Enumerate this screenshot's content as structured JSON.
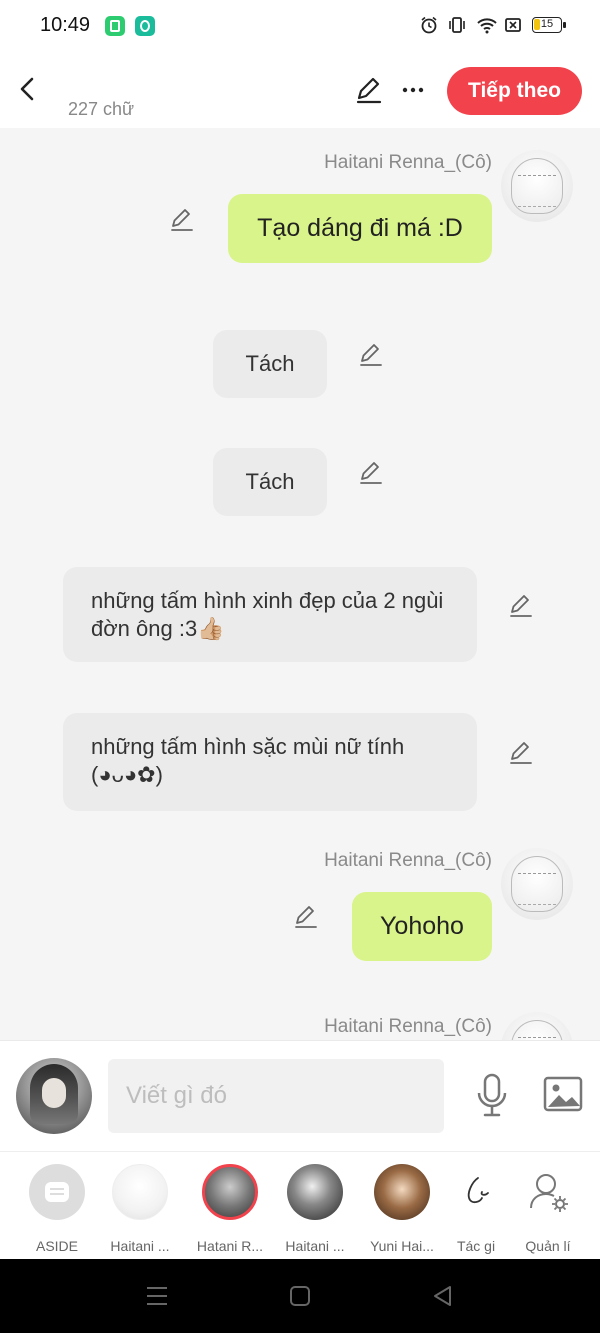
{
  "status_bar": {
    "time": "10:49",
    "battery": "15",
    "icons": [
      "app-battery-icon",
      "app-gear-icon",
      "alarm-icon",
      "vibrate-icon",
      "wifi-icon",
      "sim-off-icon",
      "battery-icon"
    ]
  },
  "top_bar": {
    "word_count": "227 chữ",
    "next_label": "Tiếp theo",
    "next_color": "#f2434d"
  },
  "messages": [
    {
      "type": "character",
      "sender": "Haitani Renna_(Cô)",
      "text": "Tạo dáng đi má :D"
    },
    {
      "type": "narration",
      "text": "Tách"
    },
    {
      "type": "narration",
      "text": "Tách"
    },
    {
      "type": "narration",
      "text": "những tấm hình xinh đẹp của 2 ngùi đờn ông :3👍🏼"
    },
    {
      "type": "narration",
      "text": "những tấm hình sặc mùi nữ tính (◕ᴗ◕✿)"
    },
    {
      "type": "character",
      "sender": "Haitani Renna_(Cô)",
      "text": "Yohoho"
    },
    {
      "type": "character",
      "sender": "Haitani Renna_(Cô)",
      "text": ""
    }
  ],
  "composer": {
    "placeholder": "Viết gì đó"
  },
  "characters": [
    {
      "name": "ASIDE"
    },
    {
      "name": "Haitani ..."
    },
    {
      "name": "Hatani R..."
    },
    {
      "name": "Haitani ..."
    },
    {
      "name": "Yuni Hai..."
    },
    {
      "name": "Tác gi"
    },
    {
      "name": "Quản lí"
    }
  ],
  "colors": {
    "green_bubble": "#d9f48a",
    "gray_bubble": "#ebebeb",
    "accent": "#f2434d"
  }
}
